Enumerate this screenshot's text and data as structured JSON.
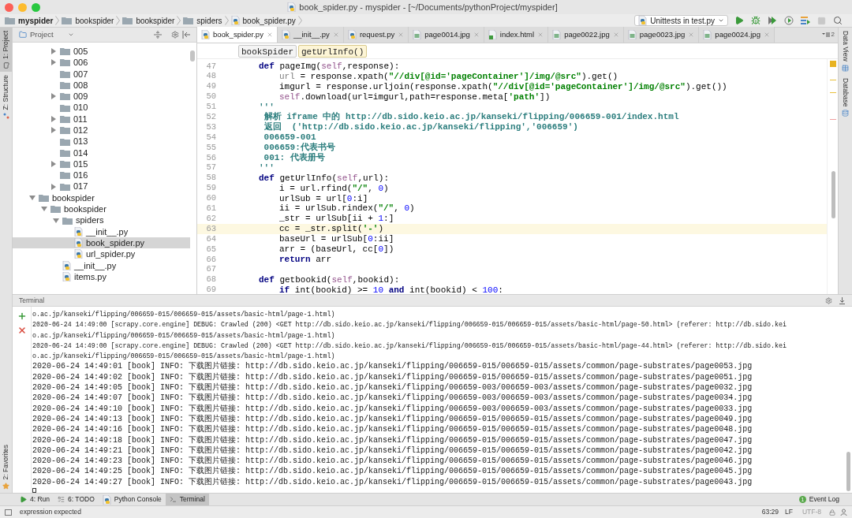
{
  "window": {
    "title": "book_spider.py - myspider - [~/Documents/pythonProject/myspider]"
  },
  "nav_bar": [
    {
      "label": "myspider",
      "kind": "project"
    },
    {
      "label": "bookspider",
      "kind": "folder"
    },
    {
      "label": "bookspider",
      "kind": "folder"
    },
    {
      "label": "spiders",
      "kind": "folder"
    },
    {
      "label": "book_spider.py",
      "kind": "python"
    }
  ],
  "run_config": {
    "label": "Unittests in test.py"
  },
  "left_tool_tabs": [
    {
      "label": "1: Project",
      "selected": true,
      "kind": "project"
    },
    {
      "label": "Z: Structure",
      "selected": false,
      "kind": "structure"
    }
  ],
  "left_bottom_tool_tabs": [
    {
      "label": "2: Favorites",
      "selected": false,
      "kind": "favorites"
    }
  ],
  "right_tool_tabs": [
    {
      "label": "Data View",
      "kind": "grid"
    },
    {
      "label": "Database",
      "kind": "database"
    }
  ],
  "project_panel": {
    "title": "Project",
    "upper_folders": [
      {
        "label": "005",
        "kind": "folder",
        "expanded": false
      },
      {
        "label": "006",
        "kind": "folder",
        "expanded": false
      },
      {
        "label": "007",
        "kind": "empty-folder"
      },
      {
        "label": "008",
        "kind": "empty-folder"
      },
      {
        "label": "009",
        "kind": "folder",
        "expanded": false
      },
      {
        "label": "010",
        "kind": "empty-folder"
      },
      {
        "label": "011",
        "kind": "folder",
        "expanded": false
      },
      {
        "label": "012",
        "kind": "folder",
        "expanded": false
      },
      {
        "label": "013",
        "kind": "empty-folder"
      },
      {
        "label": "014",
        "kind": "empty-folder"
      },
      {
        "label": "015",
        "kind": "folder",
        "expanded": false
      },
      {
        "label": "016",
        "kind": "empty-folder"
      },
      {
        "label": "017",
        "kind": "folder",
        "expanded": false
      }
    ],
    "tree": [
      {
        "label": "bookspider",
        "kind": "folder",
        "expanded": true,
        "selected": false,
        "children": [
          {
            "label": "bookspider",
            "kind": "folder",
            "expanded": true,
            "selected": false,
            "children": [
              {
                "label": "spiders",
                "kind": "folder",
                "expanded": true,
                "selected": false,
                "children": [
                  {
                    "label": "__init__.py",
                    "kind": "python",
                    "selected": false
                  },
                  {
                    "label": "book_spider.py",
                    "kind": "python",
                    "selected": true
                  },
                  {
                    "label": "url_spider.py",
                    "kind": "python",
                    "selected": false
                  }
                ]
              },
              {
                "label": "__init__.py",
                "kind": "python",
                "selected": false
              },
              {
                "label": "items.py",
                "kind": "python",
                "selected": false
              }
            ]
          }
        ]
      }
    ]
  },
  "editor_tabs": [
    {
      "label": "book_spider.py",
      "kind": "python",
      "selected": true
    },
    {
      "label": "__init__.py",
      "kind": "python",
      "selected": false
    },
    {
      "label": "request.py",
      "kind": "python",
      "selected": false
    },
    {
      "label": "page0014.jpg",
      "kind": "image",
      "selected": false
    },
    {
      "label": "index.html",
      "kind": "html",
      "selected": false
    },
    {
      "label": "page0022.jpg",
      "kind": "image",
      "selected": false
    },
    {
      "label": "page0023.jpg",
      "kind": "image",
      "selected": false
    },
    {
      "label": "page0024.jpg",
      "kind": "image",
      "selected": false
    }
  ],
  "hidden_tabs_count": "2",
  "editor_breadcrumbs": [
    {
      "label": "bookSpider",
      "selected": false
    },
    {
      "label": "getUrlInfo()",
      "selected": true
    }
  ],
  "code_lines": [
    {
      "number": "47",
      "current": false,
      "kind": "outer",
      "segments": [
        {
          "text": "def",
          "kind": "keyword"
        },
        {
          "text": " pageImg("
        },
        {
          "text": "self",
          "kind": "self"
        },
        {
          "text": ",response):"
        }
      ]
    },
    {
      "number": "48",
      "current": false,
      "kind": "inner",
      "segments": [
        {
          "text": "url",
          "kind": "unused"
        },
        {
          "text": " = response.xpath("
        },
        {
          "text": "\"//div[@id='pageContainer']/img/@src\"",
          "kind": "string"
        },
        {
          "text": ").get()"
        }
      ]
    },
    {
      "number": "49",
      "current": false,
      "kind": "inner",
      "segments": [
        {
          "text": "imgurl = response.urljoin(response.xpath("
        },
        {
          "text": "\"//div[@id='pageContainer']/img/@src\"",
          "kind": "string"
        },
        {
          "text": ").get())"
        }
      ]
    },
    {
      "number": "50",
      "current": false,
      "kind": "inner",
      "segments": [
        {
          "text": "self",
          "kind": "self"
        },
        {
          "text": ".download(url=imgurl,path=response.meta["
        },
        {
          "text": "'path'",
          "kind": "string"
        },
        {
          "text": "])"
        }
      ]
    },
    {
      "number": "51",
      "current": false,
      "kind": "outer",
      "segments": [
        {
          "text": "'''",
          "kind": "doc"
        }
      ]
    },
    {
      "number": "52",
      "current": false,
      "kind": "outer",
      "segments": [
        {
          "text": " 解析 iframe 中的 http://db.sido.keio.ac.jp/kanseki/flipping/006659-001/index.html",
          "kind": "doc"
        }
      ]
    },
    {
      "number": "53",
      "current": false,
      "kind": "outer",
      "segments": [
        {
          "text": " 返回  ('http://db.sido.keio.ac.jp/kanseki/flipping','006659')",
          "kind": "doc"
        }
      ]
    },
    {
      "number": "54",
      "current": false,
      "kind": "outer",
      "segments": [
        {
          "text": " 006659-001",
          "kind": "doc"
        }
      ]
    },
    {
      "number": "55",
      "current": false,
      "kind": "outer",
      "segments": [
        {
          "text": " 006659:代表书号",
          "kind": "doc"
        }
      ]
    },
    {
      "number": "56",
      "current": false,
      "kind": "outer",
      "segments": [
        {
          "text": " 001: 代表册号",
          "kind": "doc"
        }
      ]
    },
    {
      "number": "57",
      "current": false,
      "kind": "outer",
      "segments": [
        {
          "text": "'''",
          "kind": "doc"
        }
      ]
    },
    {
      "number": "58",
      "current": false,
      "kind": "outer",
      "segments": [
        {
          "text": "def",
          "kind": "keyword"
        },
        {
          "text": " getUrlInfo("
        },
        {
          "text": "self",
          "kind": "self"
        },
        {
          "text": ",url):"
        }
      ]
    },
    {
      "number": "59",
      "current": false,
      "kind": "inner",
      "segments": [
        {
          "text": "i = url.rfind("
        },
        {
          "text": "\"/\"",
          "kind": "string"
        },
        {
          "text": ", "
        },
        {
          "text": "0",
          "kind": "number"
        },
        {
          "text": ")"
        }
      ]
    },
    {
      "number": "60",
      "current": false,
      "kind": "inner",
      "segments": [
        {
          "text": "urlSub = url["
        },
        {
          "text": "0",
          "kind": "number"
        },
        {
          "text": ":i]"
        }
      ]
    },
    {
      "number": "61",
      "current": false,
      "kind": "inner",
      "segments": [
        {
          "text": "ii = urlSub.rindex("
        },
        {
          "text": "\"/\"",
          "kind": "string"
        },
        {
          "text": ", "
        },
        {
          "text": "0",
          "kind": "number"
        },
        {
          "text": ")"
        }
      ]
    },
    {
      "number": "62",
      "current": false,
      "kind": "inner",
      "segments": [
        {
          "text": "_str = urlSub[ii + "
        },
        {
          "text": "1",
          "kind": "number"
        },
        {
          "text": ":]"
        }
      ]
    },
    {
      "number": "63",
      "current": true,
      "kind": "inner",
      "segments": [
        {
          "text": "cc = _str.split("
        },
        {
          "text": "'-'",
          "kind": "string"
        },
        {
          "text": ")"
        }
      ]
    },
    {
      "number": "64",
      "current": false,
      "kind": "inner",
      "segments": [
        {
          "text": "baseUrl = urlSub["
        },
        {
          "text": "0",
          "kind": "number"
        },
        {
          "text": ":ii]"
        }
      ]
    },
    {
      "number": "65",
      "current": false,
      "kind": "inner",
      "segments": [
        {
          "text": "arr = (baseUrl, cc["
        },
        {
          "text": "0",
          "kind": "number"
        },
        {
          "text": "])"
        }
      ]
    },
    {
      "number": "66",
      "current": false,
      "kind": "inner",
      "segments": [
        {
          "text": "return",
          "kind": "keyword"
        },
        {
          "text": " arr"
        }
      ]
    },
    {
      "number": "67",
      "current": false
    },
    {
      "number": "68",
      "current": false,
      "kind": "outer",
      "segments": [
        {
          "text": "def",
          "kind": "keyword"
        },
        {
          "text": " getbookid("
        },
        {
          "text": "self",
          "kind": "self"
        },
        {
          "text": ",bookid):"
        }
      ]
    },
    {
      "number": "69",
      "current": false,
      "kind": "inner",
      "segments": [
        {
          "text": "if",
          "kind": "keyword"
        },
        {
          "text": " int(bookid) >= "
        },
        {
          "text": "10",
          "kind": "number"
        },
        {
          "text": " and",
          "kind": "keyword"
        },
        {
          "text": " int(bookid) < "
        },
        {
          "text": "100",
          "kind": "number"
        },
        {
          "text": ":"
        }
      ]
    }
  ],
  "terminal": {
    "title": "Terminal",
    "lines": [
      {
        "kind": "debug",
        "text": "o.ac.jp/kanseki/flipping/006659-015/006659-015/assets/basic-html/page-1.html)"
      },
      {
        "kind": "debug",
        "text": "2020-06-24 14:49:00 [scrapy.core.engine] DEBUG: Crawled (200) <GET http://db.sido.keio.ac.jp/kanseki/flipping/006659-015/006659-015/assets/basic-html/page-50.html> (referer: http://db.sido.kei"
      },
      {
        "kind": "debug",
        "text": "o.ac.jp/kanseki/flipping/006659-015/006659-015/assets/basic-html/page-1.html)"
      },
      {
        "kind": "debug",
        "text": "2020-06-24 14:49:00 [scrapy.core.engine] DEBUG: Crawled (200) <GET http://db.sido.keio.ac.jp/kanseki/flipping/006659-015/006659-015/assets/basic-html/page-44.html> (referer: http://db.sido.kei"
      },
      {
        "kind": "debug",
        "text": "o.ac.jp/kanseki/flipping/006659-015/006659-015/assets/basic-html/page-1.html)"
      },
      {
        "kind": "info",
        "text": "2020-06-24 14:49:01 [book] INFO: 下载图片链接: http://db.sido.keio.ac.jp/kanseki/flipping/006659-015/006659-015/assets/common/page-substrates/page0053.jpg"
      },
      {
        "kind": "info",
        "text": "2020-06-24 14:49:02 [book] INFO: 下载图片链接: http://db.sido.keio.ac.jp/kanseki/flipping/006659-015/006659-015/assets/common/page-substrates/page0051.jpg"
      },
      {
        "kind": "info",
        "text": "2020-06-24 14:49:05 [book] INFO: 下载图片链接: http://db.sido.keio.ac.jp/kanseki/flipping/006659-003/006659-003/assets/common/page-substrates/page0032.jpg"
      },
      {
        "kind": "info",
        "text": "2020-06-24 14:49:07 [book] INFO: 下载图片链接: http://db.sido.keio.ac.jp/kanseki/flipping/006659-003/006659-003/assets/common/page-substrates/page0034.jpg"
      },
      {
        "kind": "info",
        "text": "2020-06-24 14:49:10 [book] INFO: 下载图片链接: http://db.sido.keio.ac.jp/kanseki/flipping/006659-003/006659-003/assets/common/page-substrates/page0033.jpg"
      },
      {
        "kind": "info",
        "text": "2020-06-24 14:49:13 [book] INFO: 下载图片链接: http://db.sido.keio.ac.jp/kanseki/flipping/006659-015/006659-015/assets/common/page-substrates/page0049.jpg"
      },
      {
        "kind": "info",
        "text": "2020-06-24 14:49:16 [book] INFO: 下载图片链接: http://db.sido.keio.ac.jp/kanseki/flipping/006659-015/006659-015/assets/common/page-substrates/page0048.jpg"
      },
      {
        "kind": "info",
        "text": "2020-06-24 14:49:18 [book] INFO: 下载图片链接: http://db.sido.keio.ac.jp/kanseki/flipping/006659-015/006659-015/assets/common/page-substrates/page0047.jpg"
      },
      {
        "kind": "info",
        "text": "2020-06-24 14:49:21 [book] INFO: 下载图片链接: http://db.sido.keio.ac.jp/kanseki/flipping/006659-015/006659-015/assets/common/page-substrates/page0042.jpg"
      },
      {
        "kind": "info",
        "text": "2020-06-24 14:49:23 [book] INFO: 下载图片链接: http://db.sido.keio.ac.jp/kanseki/flipping/006659-015/006659-015/assets/common/page-substrates/page0046.jpg"
      },
      {
        "kind": "info",
        "text": "2020-06-24 14:49:25 [book] INFO: 下载图片链接: http://db.sido.keio.ac.jp/kanseki/flipping/006659-015/006659-015/assets/common/page-substrates/page0045.jpg"
      },
      {
        "kind": "info",
        "text": "2020-06-24 14:49:27 [book] INFO: 下载图片链接: http://db.sido.keio.ac.jp/kanseki/flipping/006659-015/006659-015/assets/common/page-substrates/page0043.jpg"
      }
    ]
  },
  "tool_window_tabs": [
    {
      "label": "4: Run",
      "kind": "run",
      "selected": false
    },
    {
      "label": "6: TODO",
      "kind": "todo",
      "selected": false
    },
    {
      "label": "Python Console",
      "kind": "python",
      "selected": false
    },
    {
      "label": "Terminal",
      "kind": "terminal",
      "selected": true
    }
  ],
  "event_log": {
    "label": "Event Log",
    "count": "1"
  },
  "status_bar": {
    "message": "expression expected",
    "position": "63:29",
    "line_separator": "LF",
    "encoding": "UTF-8"
  }
}
